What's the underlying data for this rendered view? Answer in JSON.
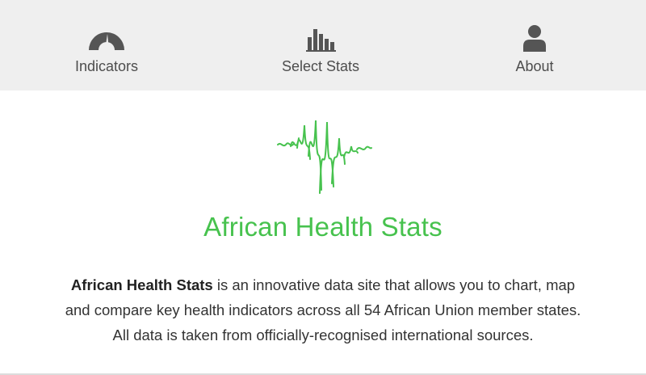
{
  "nav": {
    "items": [
      {
        "label": "Indicators",
        "icon": "gauge-icon"
      },
      {
        "label": "Select Stats",
        "icon": "bar-chart-icon"
      },
      {
        "label": "About",
        "icon": "user-icon"
      }
    ]
  },
  "logo": {
    "icon": "africa-soundwave-logo"
  },
  "site": {
    "title": "African Health Stats"
  },
  "intro": {
    "bold": "African Health Stats",
    "line1": " is an innovative data site that allows you to chart, map",
    "line2": "and compare key health indicators across all 54 African Union member states.",
    "line3": "All data is taken from officially-recognised international sources."
  },
  "colors": {
    "brand_green": "#47c24e",
    "nav_bg": "#efefef",
    "icon_gray": "#555555"
  }
}
